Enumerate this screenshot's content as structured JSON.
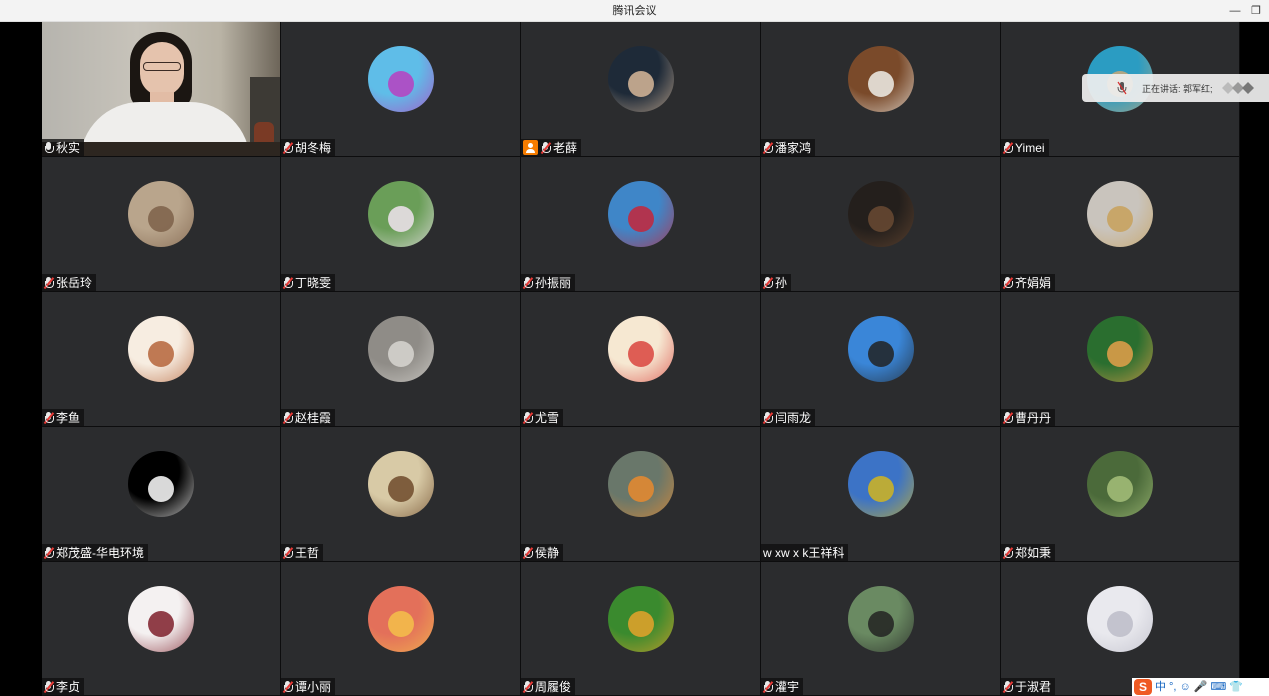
{
  "window": {
    "title": "腾讯会议"
  },
  "speaking_indicator": {
    "label": "正在讲话: 郭军红;"
  },
  "ime_toolbar": {
    "logo": "S",
    "items": [
      "中",
      "°,",
      "☺",
      "🎤",
      "⌨",
      "👕"
    ]
  },
  "participants": [
    {
      "name": "秋实",
      "mic": "on",
      "type": "video"
    },
    {
      "name": "胡冬梅",
      "mic": "muted",
      "colors": [
        "#5fbde8",
        "#b83fc0"
      ]
    },
    {
      "name": "老薛",
      "mic": "muted",
      "host": true,
      "colors": [
        "#1e2a38",
        "#d8b99a"
      ]
    },
    {
      "name": "潘家鸿",
      "mic": "muted",
      "colors": [
        "#7a4a2a",
        "#f0efe9"
      ]
    },
    {
      "name": "Yimei",
      "mic": "muted",
      "colors": [
        "#2b9cc2",
        "#c9a878"
      ]
    },
    {
      "name": "张岳玲",
      "mic": "muted",
      "colors": [
        "#b9a58c",
        "#7c6049"
      ]
    },
    {
      "name": "丁晓雯",
      "mic": "muted",
      "colors": [
        "#6a9e58",
        "#f0e3ef"
      ]
    },
    {
      "name": "孙振丽",
      "mic": "muted",
      "colors": [
        "#3f86c8",
        "#c5263a"
      ]
    },
    {
      "name": "孙",
      "mic": "muted",
      "colors": [
        "#241f1c",
        "#6a4a33"
      ]
    },
    {
      "name": "齐娟娟",
      "mic": "muted",
      "colors": [
        "#c9c4bd",
        "#c8a15a"
      ]
    },
    {
      "name": "李鱼",
      "mic": "muted",
      "colors": [
        "#f7ede1",
        "#b5643a"
      ]
    },
    {
      "name": "赵桂霞",
      "mic": "muted",
      "colors": [
        "#8f8c87",
        "#d8d6d1"
      ]
    },
    {
      "name": "尤雪",
      "mic": "muted",
      "colors": [
        "#f6e8d2",
        "#d9443e"
      ]
    },
    {
      "name": "闫雨龙",
      "mic": "muted",
      "colors": [
        "#3a86d8",
        "#222"
      ]
    },
    {
      "name": "曹丹丹",
      "mic": "muted",
      "colors": [
        "#2a6e2f",
        "#e5a04a"
      ]
    },
    {
      "name": "郑茂盛-华电环境",
      "mic": "muted",
      "colors": [
        "#000",
        "#fff"
      ]
    },
    {
      "name": "王哲",
      "mic": "muted",
      "colors": [
        "#d8caa6",
        "#6e4a2a"
      ]
    },
    {
      "name": "侯静",
      "mic": "muted",
      "colors": [
        "#69776a",
        "#e98a2e"
      ]
    },
    {
      "name": "w xw x k王祥科",
      "mic": "none",
      "colors": [
        "#3c73c6",
        "#d1b51e"
      ]
    },
    {
      "name": "郑如秉",
      "mic": "muted",
      "colors": [
        "#4b6a3a",
        "#a6c07a"
      ]
    },
    {
      "name": "李贞",
      "mic": "muted",
      "colors": [
        "#f4f1f1",
        "#7e1f2a"
      ]
    },
    {
      "name": "谭小丽",
      "mic": "muted",
      "colors": [
        "#e3705a",
        "#f4c04a"
      ]
    },
    {
      "name": "周履俊",
      "mic": "muted",
      "colors": [
        "#3a8a2e",
        "#e6a22a"
      ]
    },
    {
      "name": "灌宇",
      "mic": "muted",
      "colors": [
        "#6a8a62",
        "#222"
      ]
    },
    {
      "name": "于淑君",
      "mic": "muted",
      "colors": [
        "#e9e9ee",
        "#bcbcc8"
      ]
    }
  ]
}
